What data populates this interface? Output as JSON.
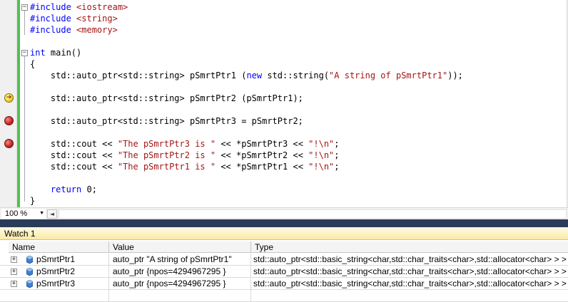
{
  "editor": {
    "lines": [
      [
        {
          "t": "#include ",
          "c": "kw"
        },
        {
          "t": "<iostream>",
          "c": "str"
        }
      ],
      [
        {
          "t": "#include ",
          "c": "kw"
        },
        {
          "t": "<string>",
          "c": "str"
        }
      ],
      [
        {
          "t": "#include ",
          "c": "kw"
        },
        {
          "t": "<memory>",
          "c": "str"
        }
      ],
      [],
      [
        {
          "t": "int",
          "c": "kw"
        },
        {
          "t": " main()"
        }
      ],
      [
        {
          "t": "{"
        }
      ],
      [
        {
          "t": "    std::auto_ptr<std::string> pSmrtPtr1 ("
        },
        {
          "t": "new",
          "c": "kw"
        },
        {
          "t": " std::string("
        },
        {
          "t": "\"A string of pSmrtPtr1\"",
          "c": "str"
        },
        {
          "t": "));"
        }
      ],
      [],
      [
        {
          "t": "    std::auto_ptr<std::string> pSmrtPtr2 (pSmrtPtr1);"
        }
      ],
      [],
      [
        {
          "t": "    std::auto_ptr<std::string> pSmrtPtr3 = pSmrtPtr2;"
        }
      ],
      [],
      [
        {
          "t": "    std::cout << "
        },
        {
          "t": "\"The pSmrtPtr3 is \"",
          "c": "str"
        },
        {
          "t": " << *pSmrtPtr3 << "
        },
        {
          "t": "\"!\\n\"",
          "c": "str"
        },
        {
          "t": ";"
        }
      ],
      [
        {
          "t": "    std::cout << "
        },
        {
          "t": "\"The pSmrtPtr2 is \"",
          "c": "str"
        },
        {
          "t": " << *pSmrtPtr2 << "
        },
        {
          "t": "\"!\\n\"",
          "c": "str"
        },
        {
          "t": ";"
        }
      ],
      [
        {
          "t": "    std::cout << "
        },
        {
          "t": "\"The pSmrtPtr1 is \"",
          "c": "str"
        },
        {
          "t": " << *pSmrtPtr1 << "
        },
        {
          "t": "\"!\\n\"",
          "c": "str"
        },
        {
          "t": ";"
        }
      ],
      [],
      [
        {
          "t": "    "
        },
        {
          "t": "return",
          "c": "kw"
        },
        {
          "t": " 0;"
        }
      ],
      [
        {
          "t": "}"
        }
      ]
    ],
    "outline_markers": [
      "−",
      "−"
    ],
    "current_statement_line": 9,
    "breakpoint_lines": [
      11,
      13
    ]
  },
  "zoombar": {
    "zoom_level": "100 %",
    "dropdown_arrow": "▼",
    "scroll_left_arrow": "◄"
  },
  "watch": {
    "title": "Watch 1",
    "columns": [
      "Name",
      "Value",
      "Type"
    ],
    "expander_glyph": "+",
    "rows": [
      {
        "name": "pSmrtPtr1",
        "value": "auto_ptr \"A string of pSmrtPtr1\"",
        "type": "std::auto_ptr<std::basic_string<char,std::char_traits<char>,std::allocator<char> > >"
      },
      {
        "name": "pSmrtPtr2",
        "value": "auto_ptr {npos=4294967295 }",
        "type": "std::auto_ptr<std::basic_string<char,std::char_traits<char>,std::allocator<char> > >"
      },
      {
        "name": "pSmrtPtr3",
        "value": "auto_ptr {npos=4294967295 }",
        "type": "std::auto_ptr<std::basic_string<char,std::char_traits<char>,std::allocator<char> > >"
      }
    ]
  },
  "icons": {
    "breakpoint": "breakpoint-icon",
    "current_statement": "current-statement-arrow-icon",
    "variable": "watch-variable-icon",
    "current_statement_glyph": "➔"
  },
  "colors": {
    "keyword": "#0000ff",
    "string": "#a31515",
    "change_bar": "#4ec34e",
    "splitter": "#2b3c59",
    "watch_title_bg": "#fbe9a5"
  }
}
